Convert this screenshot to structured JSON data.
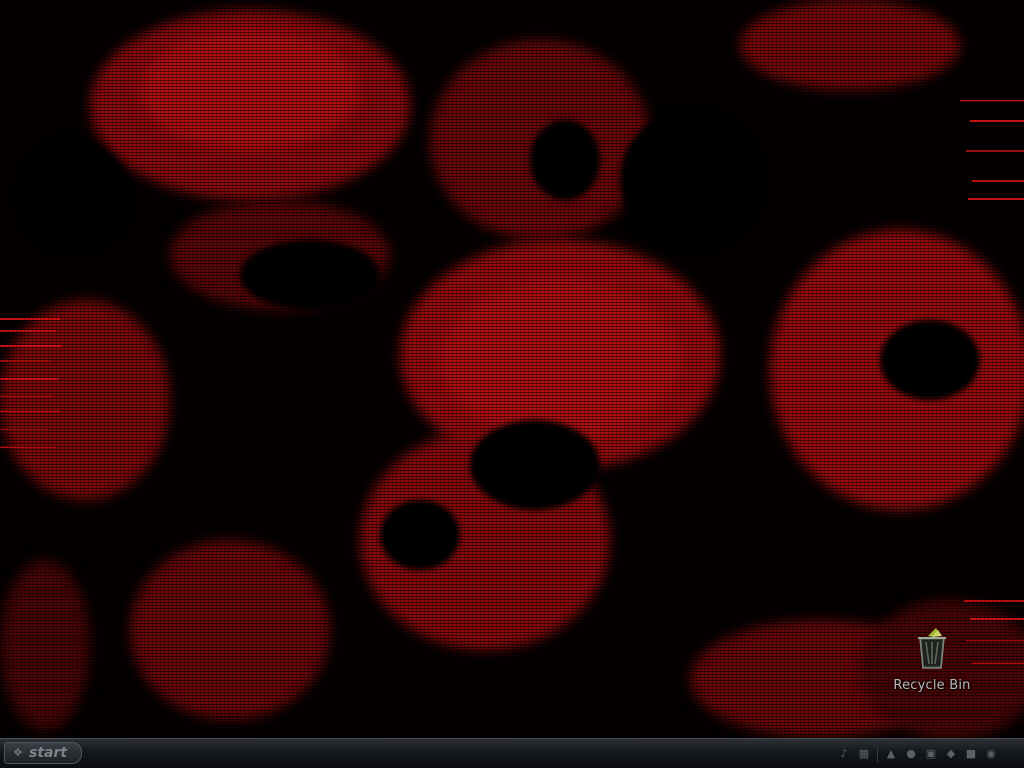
{
  "desktop": {
    "accent_color": "#b8080c",
    "icons": [
      {
        "label": "Recycle Bin",
        "icon": "recycle-bin-icon"
      }
    ]
  },
  "taskbar": {
    "start_label": "start",
    "tray_icons": [
      "speaker-icon",
      "network-icon",
      "shield-icon",
      "power-icon",
      "chat-icon",
      "bluetooth-icon",
      "usb-icon",
      "antivirus-icon"
    ],
    "clock": ""
  }
}
